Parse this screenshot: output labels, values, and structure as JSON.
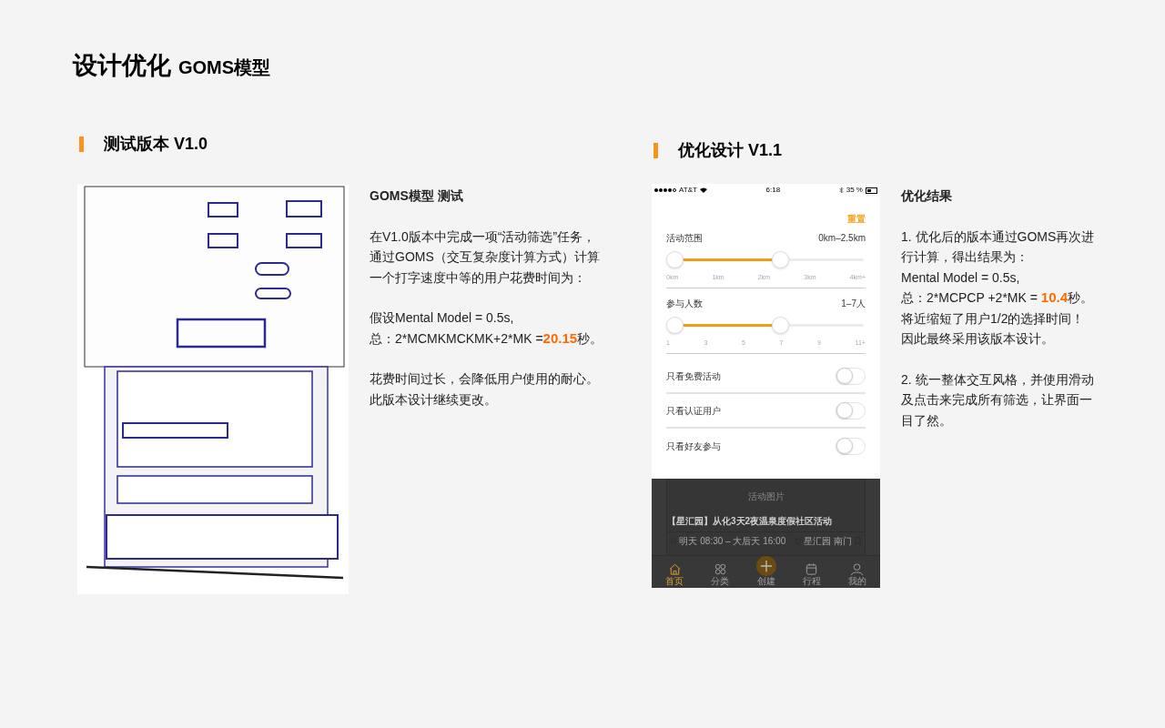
{
  "page_title": {
    "main": "设计优化",
    "sub": "GOMS模型"
  },
  "left_section": {
    "heading": "测试版本 V1.0",
    "notes": {
      "title": "GOMS模型 测试",
      "paragraphs": [
        {
          "lines": [
            {
              "text": "在V1.0版本中完成一项“活动筛选”任务，"
            },
            {
              "text": "通过GOMS（交互复杂度计算方式）计算"
            },
            {
              "text": "一个打字速度中等的用户花费时间为："
            }
          ]
        },
        {
          "lines": [
            {
              "text": "假设Mental Model = 0.5s,"
            },
            {
              "parts": [
                {
                  "text": "总：2*MCMKMCKMK+2*MK =",
                  "highlight": false
                },
                {
                  "text": "20.15",
                  "highlight": true
                },
                {
                  "text": "秒。",
                  "highlight": false
                }
              ]
            }
          ]
        },
        {
          "lines": [
            {
              "text": "花费时间过长，会降低用户使用的耐心。"
            },
            {
              "text": "此版本设计继续更改。"
            }
          ]
        }
      ]
    }
  },
  "right_section": {
    "heading": "优化设计 V1.1",
    "phone": {
      "status_bar": {
        "carrier": "AT&T",
        "time": "6:18",
        "battery": "35 %"
      },
      "reset": "重置",
      "sliders": [
        {
          "label": "活动范围",
          "reading": "0km–2.5km",
          "level": 0.58,
          "ticks": [
            "0km",
            "1km",
            "2km",
            "3km",
            "4km+"
          ]
        },
        {
          "label": "参与人数",
          "reading": "1–7人",
          "level": 0.58,
          "ticks": [
            "1",
            "3",
            "5",
            "7",
            "9",
            "11+"
          ]
        }
      ],
      "toggles": [
        {
          "label": "只看免费活动",
          "on": false
        },
        {
          "label": "只看认证用户",
          "on": false
        },
        {
          "label": "只看好友参与",
          "on": false
        }
      ],
      "background_card": {
        "image_label": "活动图片",
        "title": "【星汇园】从化3天2夜温泉度假社区活动",
        "time": "明天 08:30 – 大后天 16:00",
        "place": "星汇园 南门"
      },
      "tab_bar": [
        {
          "label": "首页",
          "selected": true
        },
        {
          "label": "分类",
          "selected": false
        },
        {
          "label": "创建",
          "selected": false
        },
        {
          "label": "行程",
          "selected": false
        },
        {
          "label": "我的",
          "selected": false
        }
      ]
    },
    "notes": {
      "title": "优化结果",
      "paragraphs": [
        {
          "lines": [
            {
              "text": "1. 优化后的版本通过GOMS再次进"
            },
            {
              "text": "行计算，得出结果为："
            },
            {
              "text": "Mental Model = 0.5s,"
            },
            {
              "parts": [
                {
                  "text": "总：2*MCPCP +2*MK = ",
                  "highlight": false
                },
                {
                  "text": "10.4",
                  "highlight": true
                },
                {
                  "text": "秒。",
                  "highlight": false
                }
              ]
            },
            {
              "text": "将近缩短了用户1/2的选择时间！"
            },
            {
              "text": "因此最终采用该版本设计。"
            }
          ]
        },
        {
          "lines": [
            {
              "text": "2. 统一整体交互风格，并使用滑动"
            },
            {
              "text": "及点击来完成所有筛选，让界面一"
            },
            {
              "text": "目了然。"
            }
          ]
        }
      ]
    }
  }
}
